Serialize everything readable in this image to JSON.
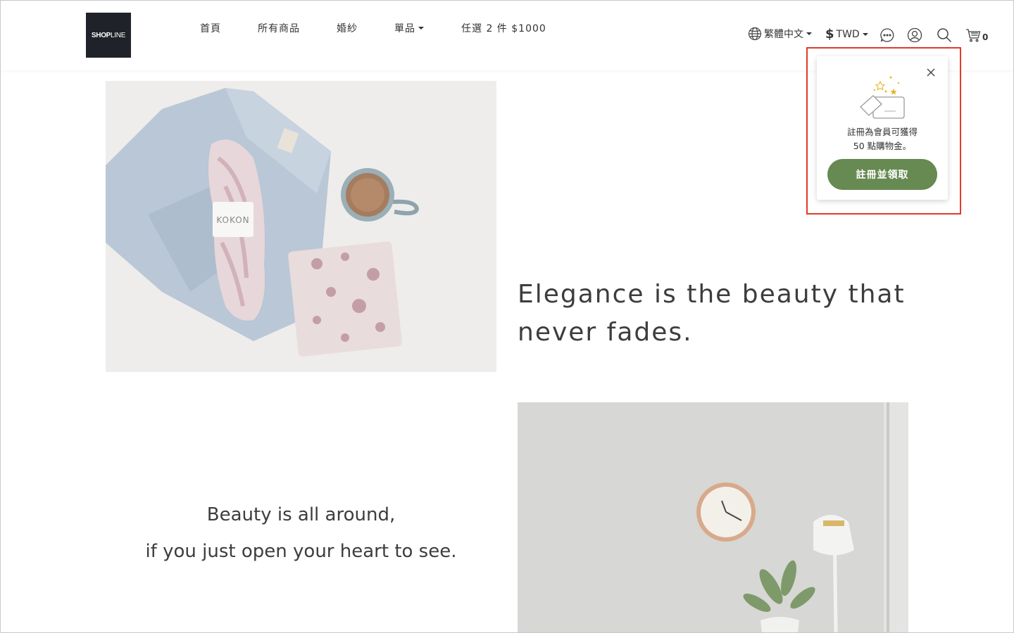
{
  "header": {
    "logo": {
      "bold": "SHOP",
      "thin": "LINE"
    },
    "nav": [
      {
        "label": "首頁"
      },
      {
        "label": "所有商品"
      },
      {
        "label": "婚紗"
      },
      {
        "label": "單品"
      },
      {
        "label": "任選 2 件 $1000"
      }
    ],
    "language": "繁體中文",
    "currency_symbol": "$",
    "currency": "TWD",
    "cart_count": "0",
    "icons": [
      "globe-icon",
      "chat-icon",
      "account-icon",
      "search-icon",
      "cart-icon"
    ]
  },
  "content": {
    "quote1": "Elegance is the beauty that never fades.",
    "quote2_line1": "Beauty is all around,",
    "quote2_line2": "if you just open your heart to see.",
    "image1_text": "KOKON"
  },
  "popup": {
    "message_line1": "註冊為會員可獲得",
    "message_line2": "50 點購物金。",
    "button_label": "註冊並領取",
    "button_color": "#668a52",
    "highlight_color": "#e23a2a"
  }
}
